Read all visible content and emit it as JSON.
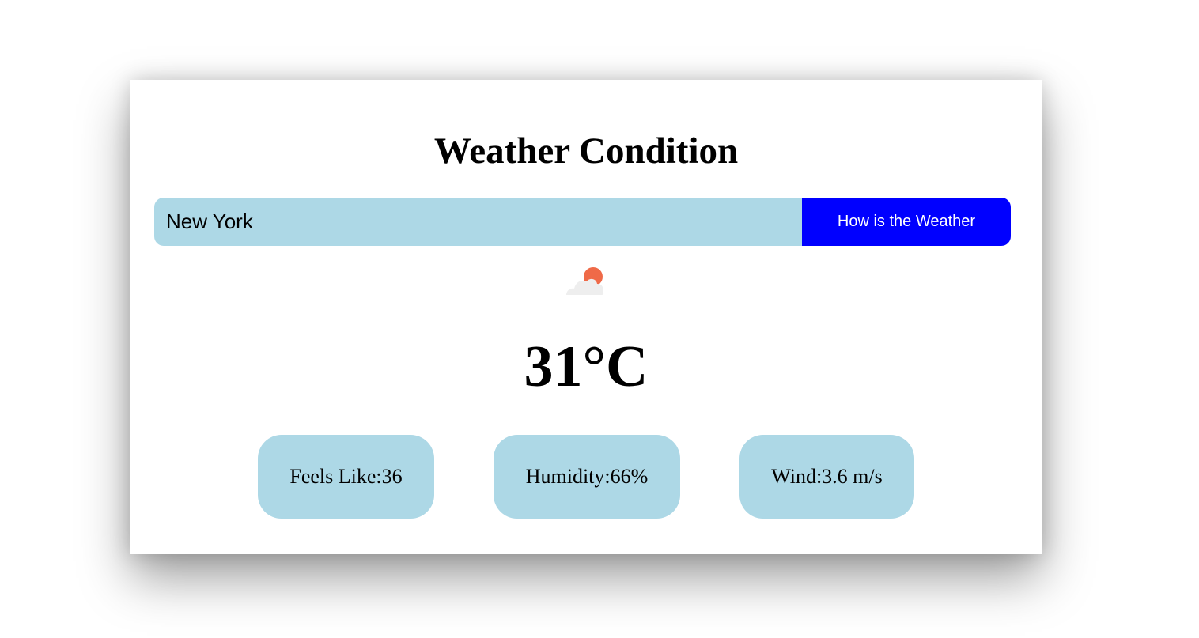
{
  "app": {
    "title": "Weather Condition"
  },
  "search": {
    "value": "New York",
    "button_label": "How is the Weather"
  },
  "weather": {
    "icon": "cloud-sun-icon",
    "temperature": "31°C",
    "feels_like": "Feels Like:36",
    "humidity": "Humidity:66%",
    "wind": "Wind:3.6 m/s"
  },
  "colors": {
    "input_background": "#add8e6",
    "button_background": "#0000ff",
    "stat_background": "#add8e6",
    "sun": "#ef6a48",
    "cloud": "#eeeeee"
  }
}
